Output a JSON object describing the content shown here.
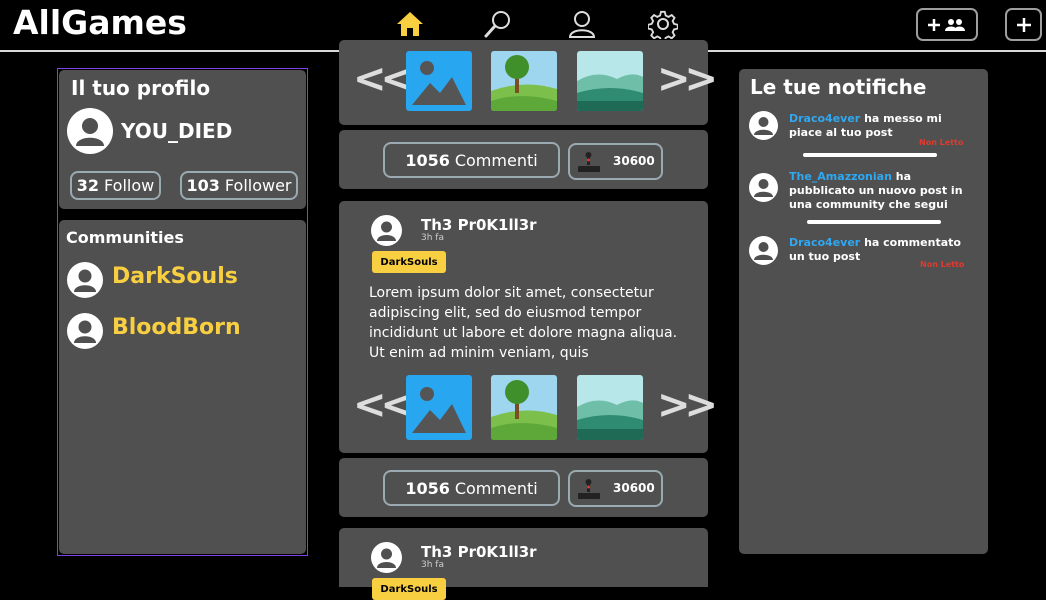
{
  "app": {
    "title": "AllGames"
  },
  "nav": {
    "icons": [
      "home-icon",
      "search-icon",
      "user-icon",
      "gear-icon"
    ],
    "active": "home",
    "accent": "#f9cf42"
  },
  "profile": {
    "title": "Il tuo profilo",
    "username": "YOU_DIED",
    "follow_count": "32",
    "follow_label": "Follow",
    "follower_count": "103",
    "follower_label": "Follower"
  },
  "communities": {
    "title": "Communities",
    "items": [
      {
        "name": "DarkSouls"
      },
      {
        "name": "BloodBorn"
      }
    ],
    "color": "#f9cf42"
  },
  "feed": {
    "posts": [
      {
        "comments_count": "1056",
        "comments_label": "Commenti",
        "score": "30600"
      },
      {
        "author": "Th3 Pr0K1ll3r",
        "time": "3h fa",
        "tag": "DarkSouls",
        "body": "Lorem ipsum dolor sit amet, consectetur adipiscing elit, sed do eiusmod tempor incididunt ut labore et dolore magna aliqua. Ut enim ad minim veniam, quis",
        "comments_count": "1056",
        "comments_label": "Commenti",
        "score": "30600"
      },
      {
        "author": "Th3 Pr0K1ll3r",
        "time": "3h fa",
        "tag": "DarkSouls"
      }
    ]
  },
  "notifications": {
    "title": "Le tue notifiche",
    "items": [
      {
        "user": "Draco4ever",
        "text": " ha messo mi piace al tuo post",
        "status": "Non Letto"
      },
      {
        "user": "The_Amazzonian",
        "text": " ha pubblicato un nuovo post in una community che segui",
        "status": ""
      },
      {
        "user": "Draco4ever",
        "text": " ha commentato un tuo post",
        "status": "Non Letto"
      }
    ]
  }
}
